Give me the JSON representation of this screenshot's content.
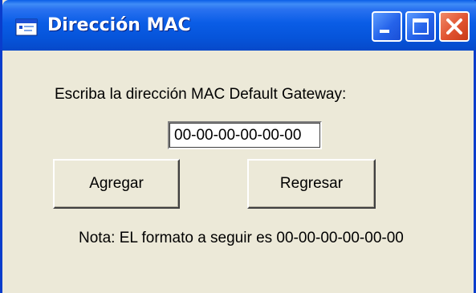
{
  "window": {
    "title": "Dirección MAC",
    "colors": {
      "titlebar": "#0a5de6",
      "face": "#ece9d8",
      "close": "#e05230"
    }
  },
  "titlebar_buttons": {
    "minimize_icon": "minimize-icon",
    "maximize_icon": "maximize-icon",
    "close_icon": "close-icon"
  },
  "form": {
    "prompt_label": "Escriba la dirección MAC Default Gateway:",
    "mac_value": "00-00-00-00-00-00",
    "add_button_label": "Agregar",
    "back_button_label": "Regresar",
    "note": "Nota: EL formato a seguir es 00-00-00-00-00-00"
  }
}
